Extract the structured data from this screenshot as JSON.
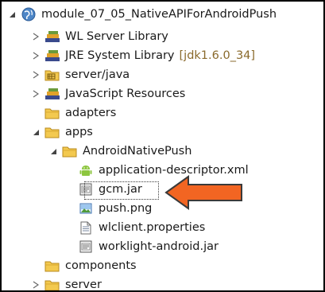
{
  "tree": {
    "project": {
      "label": "module_07_05_NativeAPIForAndroidPush",
      "icon": "project-globe-icon"
    },
    "wl_server_library": {
      "label": "WL Server Library",
      "icon": "library-books-icon"
    },
    "jre_library": {
      "label": "JRE System Library",
      "decoration": "[jdk1.6.0_34]",
      "icon": "library-books-icon"
    },
    "server_java": {
      "label": "server/java",
      "icon": "source-folder-icon"
    },
    "js_resources": {
      "label": "JavaScript Resources",
      "icon": "library-books-icon"
    },
    "adapters": {
      "label": "adapters",
      "icon": "folder-icon"
    },
    "apps": {
      "label": "apps",
      "icon": "folder-icon"
    },
    "android_native_push": {
      "label": "AndroidNativePush",
      "icon": "folder-icon"
    },
    "app_descriptor": {
      "label": "application-descriptor.xml",
      "icon": "android-icon"
    },
    "gcm_jar": {
      "label": "gcm.jar",
      "icon": "jar-file-icon"
    },
    "push_png": {
      "label": "push.png",
      "icon": "image-file-icon"
    },
    "wlclient": {
      "label": "wlclient.properties",
      "icon": "text-file-icon"
    },
    "worklight_jar": {
      "label": "worklight-android.jar",
      "icon": "jar-file-icon"
    },
    "components": {
      "label": "components",
      "icon": "folder-icon"
    },
    "server": {
      "label": "server",
      "icon": "folder-icon"
    }
  },
  "colors": {
    "arrow_fill": "#f26522",
    "arrow_stroke": "#3a3a3a",
    "folder": "#f3c94f",
    "decoration_text": "#8a6a2c"
  }
}
